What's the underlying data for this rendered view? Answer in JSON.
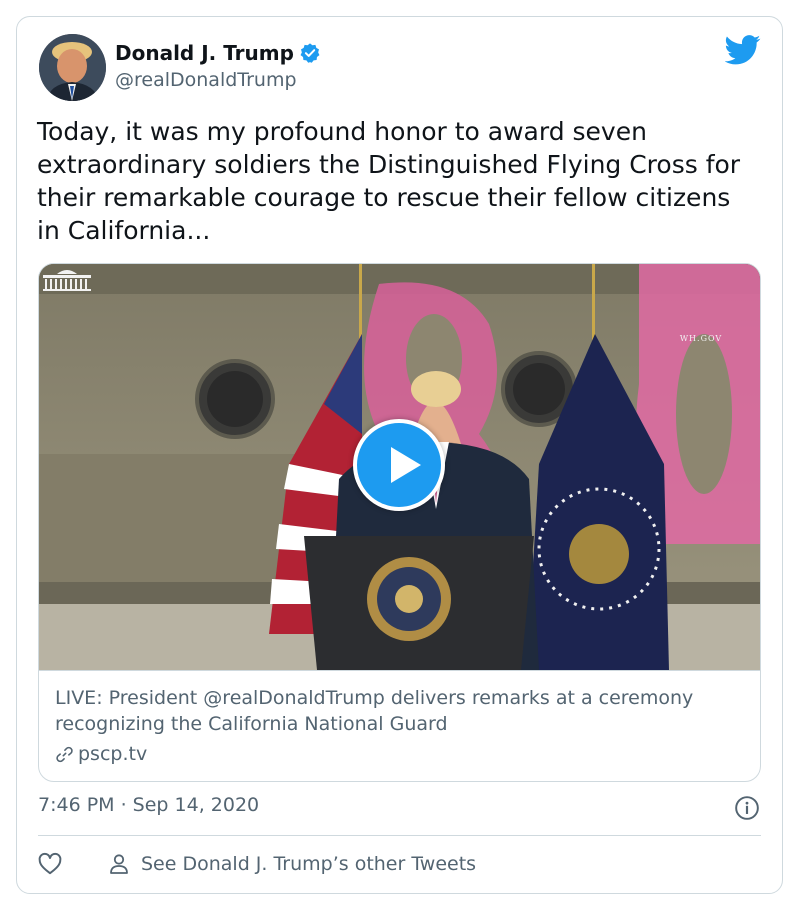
{
  "author": {
    "name": "Donald J. Trump",
    "handle": "@realDonaldTrump",
    "verified": true,
    "avatar_icon": "profile-photo"
  },
  "brand_icon": "twitter-bird-icon",
  "colors": {
    "accent": "#1d9bf0",
    "text": "#0f1419",
    "muted": "#536471",
    "border": "#cfd9de"
  },
  "tweet": {
    "text": "Today, it was my profound honor to award seven extraordinary soldiers the Distinguished Flying Cross for their remarkable courage to rescue their fellow citizens in California..."
  },
  "media": {
    "watermark": "WH.GOV",
    "play_icon": "play-icon",
    "link_title": "LIVE: President @realDonaldTrump delivers remarks at a ceremony recognizing the California National Guard",
    "link_domain": "pscp.tv",
    "link_icon": "link-icon"
  },
  "meta": {
    "timestamp": "7:46 PM · Sep 14, 2020",
    "info_icon": "info-icon"
  },
  "actions": {
    "like_icon": "heart-icon",
    "other_tweets_icon": "person-icon",
    "other_tweets_label": "See Donald J. Trump’s other Tweets"
  }
}
